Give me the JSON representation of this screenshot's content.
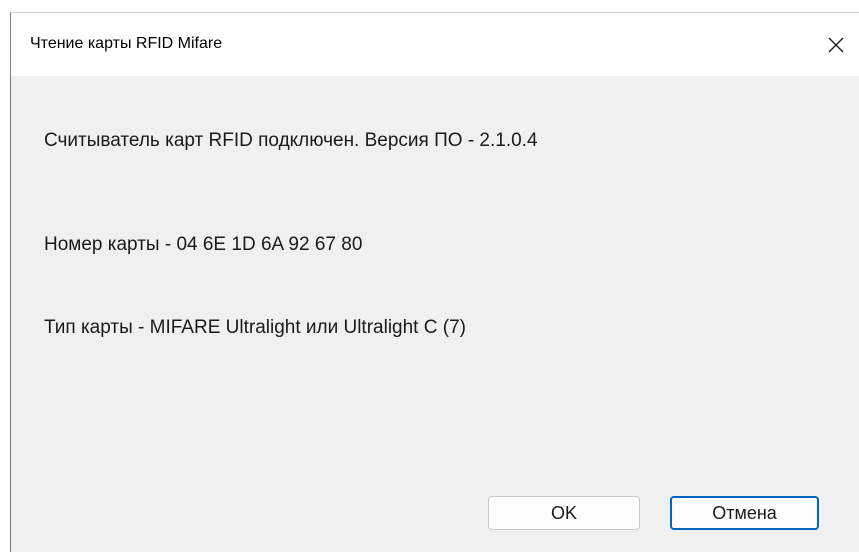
{
  "dialog": {
    "title": "Чтение карты RFID Mifare",
    "close_icon": "close-icon"
  },
  "content": {
    "reader_status": "Считыватель карт RFID подключен. Версия ПО - 2.1.0.4",
    "card_number": "Номер карты - 04 6E 1D 6A 92 67 80",
    "card_type": "Тип карты - MIFARE Ultralight или Ultralight C (7)"
  },
  "buttons": {
    "ok_label": "OK",
    "cancel_label": "Отмена"
  },
  "colors": {
    "focus_accent": "#0067c0",
    "dialog_background": "#f0f0f0",
    "titlebar_background": "#ffffff"
  }
}
